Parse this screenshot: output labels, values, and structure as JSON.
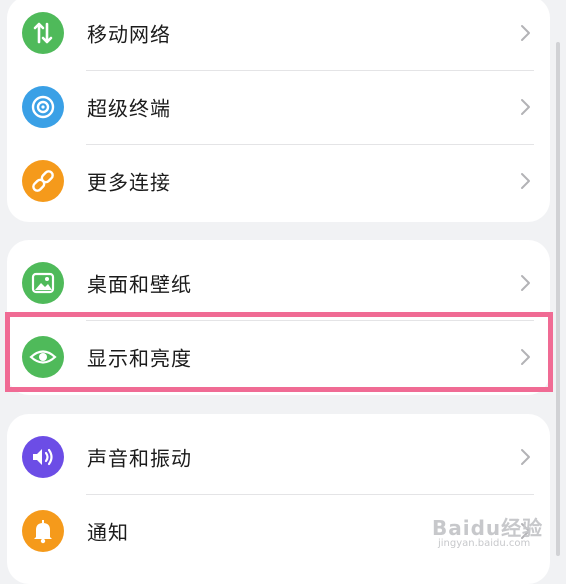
{
  "groups": [
    {
      "items": [
        {
          "label": "移动网络",
          "icon": "mobile-data-icon",
          "color": "#4fba5a"
        },
        {
          "label": "超级终端",
          "icon": "super-device-icon",
          "color": "#3aa0e6"
        },
        {
          "label": "更多连接",
          "icon": "link-icon",
          "color": "#f59a1b"
        }
      ]
    },
    {
      "items": [
        {
          "label": "桌面和壁纸",
          "icon": "wallpaper-icon",
          "color": "#4fba5a"
        },
        {
          "label": "显示和亮度",
          "icon": "eye-icon",
          "color": "#4fba5a"
        }
      ]
    },
    {
      "items": [
        {
          "label": "声音和振动",
          "icon": "speaker-icon",
          "color": "#6c4de6"
        },
        {
          "label": "通知",
          "icon": "bell-icon",
          "color": "#f59a1b"
        }
      ]
    }
  ],
  "highlight_color": "#f06b94",
  "watermark": {
    "text": "Baidu经验",
    "sub": "jingyan.baidu.com"
  }
}
